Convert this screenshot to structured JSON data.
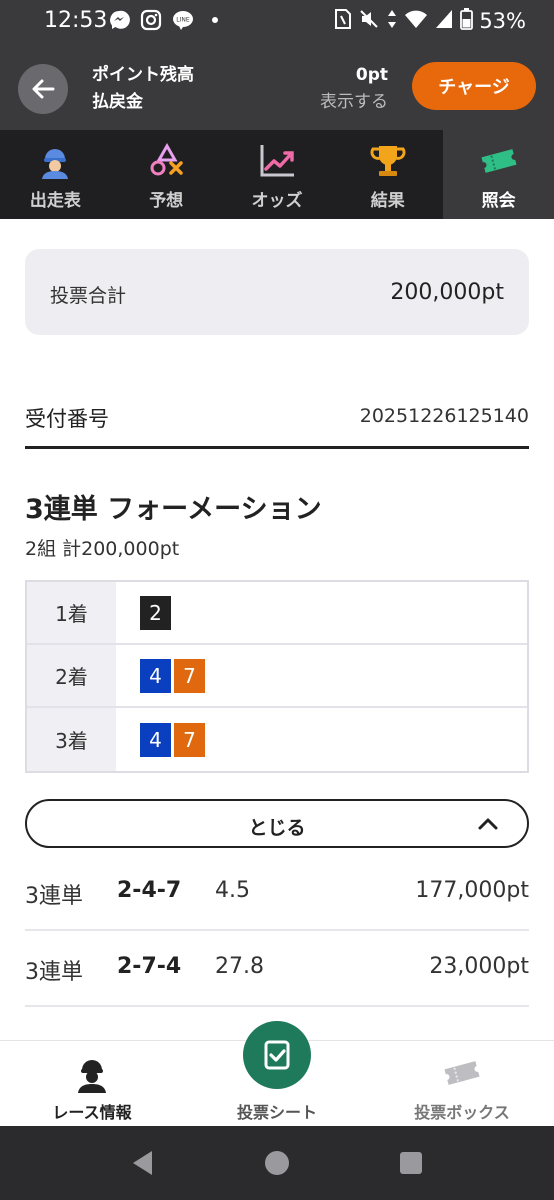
{
  "status_bar": {
    "time": "12:53",
    "battery": "53%",
    "left_icons": [
      "messenger-icon",
      "instagram-icon",
      "line-icon",
      "dot-icon"
    ],
    "right_icons": [
      "sim-icon",
      "mute-icon",
      "data-arrows-icon",
      "wifi-icon",
      "signal-icon",
      "battery-icon"
    ]
  },
  "header": {
    "points_label": "ポイント残高",
    "refund_label": "払戻金",
    "points_value": "0pt",
    "show_label": "表示する",
    "charge_button": "チャージ"
  },
  "tabs": [
    {
      "label": "出走表",
      "icon": "jockey-icon",
      "active": false
    },
    {
      "label": "予想",
      "icon": "prediction-icon",
      "active": false
    },
    {
      "label": "オッズ",
      "icon": "odds-chart-icon",
      "active": false
    },
    {
      "label": "結果",
      "icon": "trophy-icon",
      "active": false
    },
    {
      "label": "照会",
      "icon": "ticket-icon",
      "active": true
    }
  ],
  "summary": {
    "label": "投票合計",
    "value": "200,000pt"
  },
  "receipt": {
    "label": "受付番号",
    "value": "20251226125140"
  },
  "bet": {
    "title": "3連単 フォーメーション",
    "subtitle": "2組 計200,000pt",
    "rows": [
      {
        "label": "1着",
        "numbers": [
          {
            "n": "2",
            "color": "#222222"
          }
        ]
      },
      {
        "label": "2着",
        "numbers": [
          {
            "n": "4",
            "color": "#0a3fbf"
          },
          {
            "n": "7",
            "color": "#e0690f"
          }
        ]
      },
      {
        "label": "3着",
        "numbers": [
          {
            "n": "4",
            "color": "#0a3fbf"
          },
          {
            "n": "7",
            "color": "#e0690f"
          }
        ]
      }
    ]
  },
  "close_button": "とじる",
  "results": [
    {
      "type": "3連単",
      "combo": "2-4-7",
      "odds": "4.5",
      "amount": "177,000pt"
    },
    {
      "type": "3連単",
      "combo": "2-7-4",
      "odds": "27.8",
      "amount": "23,000pt"
    }
  ],
  "bottom_nav": {
    "race_info": "レース情報",
    "vote_sheet": "投票シート",
    "vote_box": "投票ボックス"
  },
  "colors": {
    "accent_orange": "#e8680c",
    "fab_green": "#1e7a5a",
    "header_dark": "#3a3a3c"
  }
}
